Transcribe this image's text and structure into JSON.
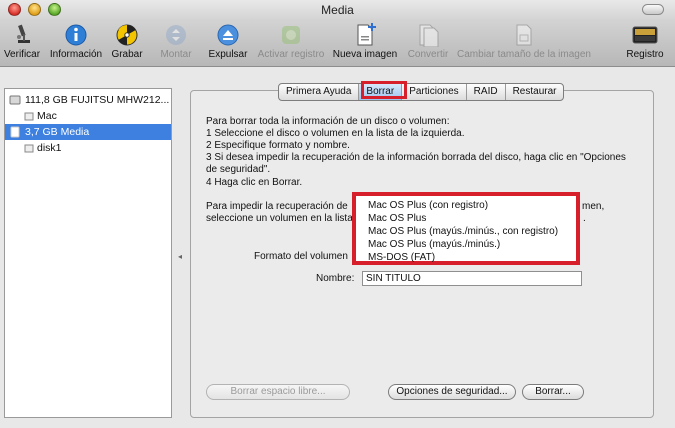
{
  "window": {
    "title": "Media"
  },
  "toolbar": {
    "items": [
      {
        "label": "Verificar",
        "icon": "microscope-icon",
        "enabled": true
      },
      {
        "label": "Información",
        "icon": "info-icon",
        "enabled": true
      },
      {
        "label": "Grabar",
        "icon": "burn-icon",
        "enabled": true
      },
      {
        "label": "Montar",
        "icon": "mount-icon",
        "enabled": false
      },
      {
        "label": "Expulsar",
        "icon": "eject-icon",
        "enabled": true
      },
      {
        "label": "Activar registro",
        "icon": "journal-icon",
        "enabled": false
      },
      {
        "label": "Nueva imagen",
        "icon": "new-image-icon",
        "enabled": true
      },
      {
        "label": "Convertir",
        "icon": "convert-icon",
        "enabled": false
      },
      {
        "label": "Cambiar tamaño de la imagen",
        "icon": "resize-image-icon",
        "enabled": false
      },
      {
        "label": "Registro",
        "icon": "log-icon",
        "enabled": true
      }
    ]
  },
  "sidebar": {
    "items": [
      {
        "label": "111,8 GB FUJITSU MHW212...",
        "type": "disk",
        "selected": false
      },
      {
        "label": "Mac",
        "type": "volume",
        "selected": false
      },
      {
        "label": "3,7 GB Media",
        "type": "disk",
        "selected": true
      },
      {
        "label": "disk1",
        "type": "volume",
        "selected": false
      }
    ]
  },
  "tabs": [
    {
      "label": "Primera Ayuda",
      "active": false
    },
    {
      "label": "Borrar",
      "active": true
    },
    {
      "label": "Particiones",
      "active": false
    },
    {
      "label": "RAID",
      "active": false
    },
    {
      "label": "Restaurar",
      "active": false
    }
  ],
  "instructions": {
    "line1": "Para borrar toda la información de un disco o volumen:",
    "line2": "1 Seleccione el disco o volumen en la lista de la izquierda.",
    "line3": "2 Especifique formato y nombre.",
    "line4": "3 Si desea impedir la recuperación de la información borrada del disco, haga clic en \"Opciones",
    "line5": "de seguridad\".",
    "line6": "4 Haga clic en Borrar.",
    "line7a": "Para impedir la recuperación de",
    "line7b": "men,",
    "line8a": "seleccione un volumen en la lista",
    "line8b": "."
  },
  "form": {
    "format_label": "Formato del volumen",
    "name_label": "Nombre:",
    "name_value": "SIN TITULO"
  },
  "format_menu": {
    "options": [
      "Mac OS Plus (con registro)",
      "Mac OS Plus",
      "Mac OS Plus (mayús./minús., con registro)",
      "Mac OS Plus (mayús./minús.)",
      "MS-DOS (FAT)"
    ]
  },
  "buttons": {
    "erase_free_space": "Borrar espacio libre...",
    "security_options": "Opciones de seguridad...",
    "erase": "Borrar..."
  },
  "colors": {
    "highlight": "#d61f2b",
    "selection": "#3d80df"
  }
}
